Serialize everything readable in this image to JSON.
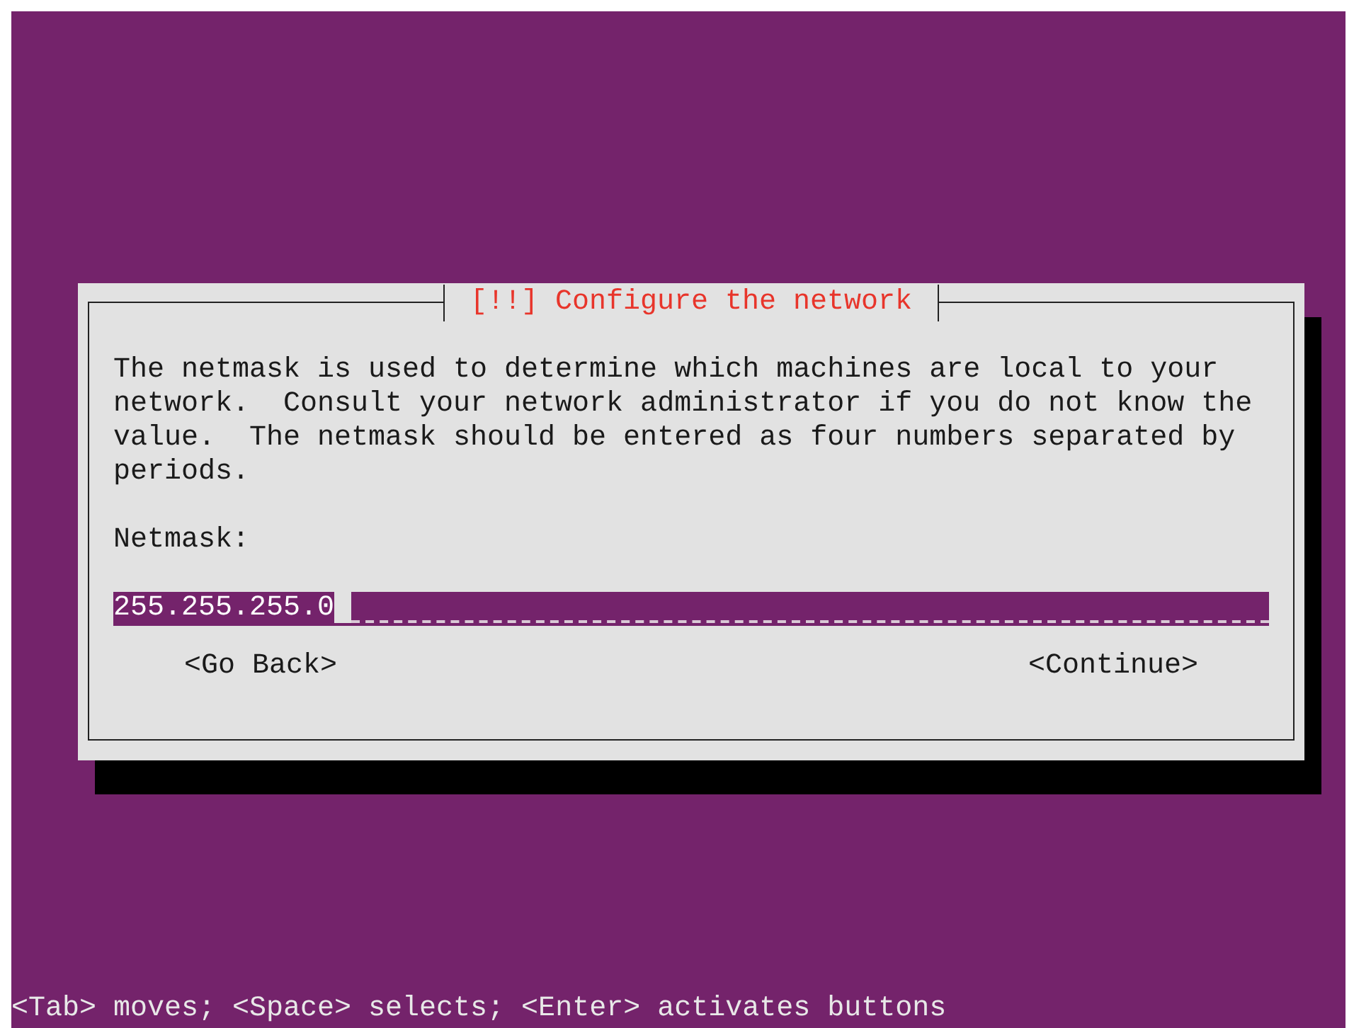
{
  "dialog": {
    "title": "[!!] Configure the network",
    "message": "The netmask is used to determine which machines are local to your network.  Consult your network administrator if you do not know the value.  The netmask should be entered as four numbers separated by periods.",
    "field": {
      "label": "Netmask:",
      "value": "255.255.255.0"
    },
    "buttons": [
      {
        "label": "<Go Back>",
        "selected": false
      },
      {
        "label": "<Continue>",
        "selected": false
      }
    ]
  },
  "help_line": "<Tab> moves; <Space> selects; <Enter> activates buttons"
}
